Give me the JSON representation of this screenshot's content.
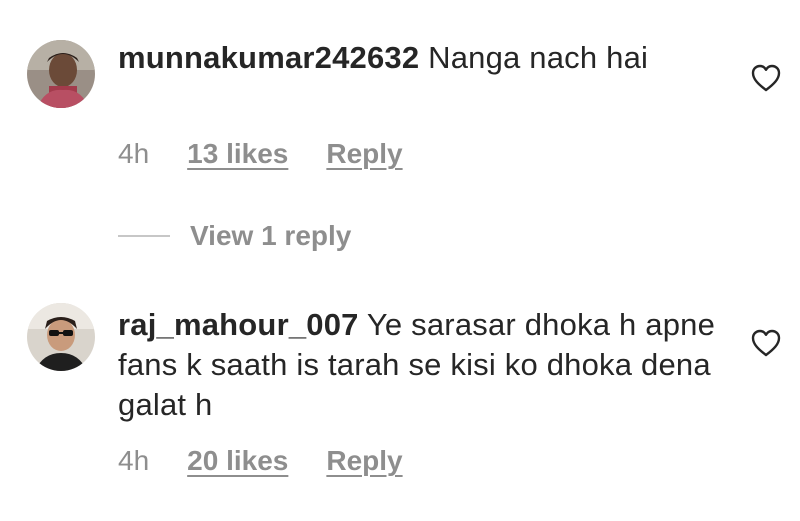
{
  "comments": [
    {
      "username": "munnakumar242632",
      "text": "Nanga nach hai",
      "time": "4h",
      "likes": "13 likes",
      "reply_label": "Reply"
    },
    {
      "username": "raj_mahour_007",
      "text": "Ye sarasar dhoka h apne fans k saath is tarah se kisi ko dhoka dena galat h",
      "time": "4h",
      "likes": "20 likes",
      "reply_label": "Reply"
    }
  ],
  "view_replies_label": "View 1 reply",
  "icons": {
    "like": "heart-outline-icon"
  },
  "colors": {
    "text": "#262626",
    "secondary": "#8e8e8e",
    "divider": "#c7c7c7"
  }
}
